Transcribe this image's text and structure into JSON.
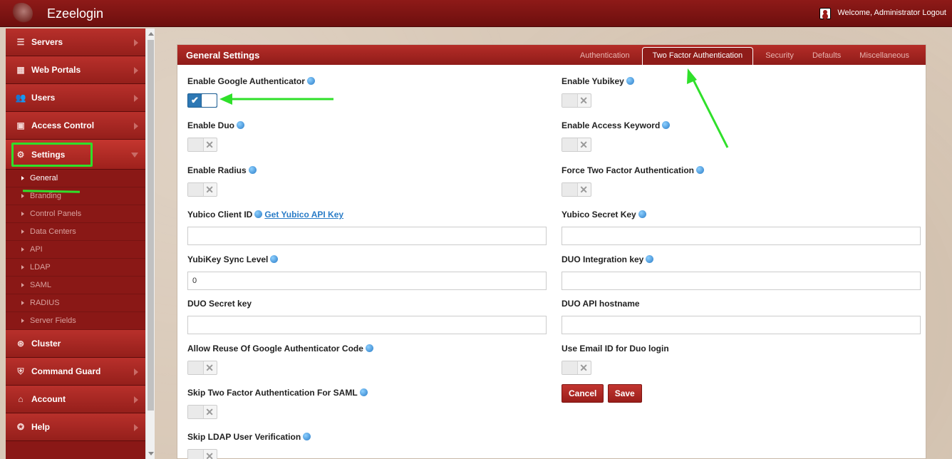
{
  "app": {
    "title": "Ezeelogin",
    "welcome": "Welcome, Administrator Logout"
  },
  "sidebar": {
    "items": [
      {
        "label": "Servers",
        "icon": "list-icon"
      },
      {
        "label": "Web Portals",
        "icon": "grid-icon"
      },
      {
        "label": "Users",
        "icon": "users-icon"
      },
      {
        "label": "Access Control",
        "icon": "lock-icon"
      },
      {
        "label": "Settings",
        "icon": "gears-icon"
      },
      {
        "label": "Cluster",
        "icon": "cluster-icon"
      },
      {
        "label": "Command Guard",
        "icon": "shield-icon"
      },
      {
        "label": "Account",
        "icon": "home-icon"
      },
      {
        "label": "Help",
        "icon": "lifebuoy-icon"
      }
    ],
    "settings_sub": [
      "General",
      "Branding",
      "Control Panels",
      "Data Centers",
      "API",
      "LDAP",
      "SAML",
      "RADIUS",
      "Server Fields"
    ]
  },
  "panel": {
    "title": "General Settings",
    "tabs": [
      "Authentication",
      "Two Factor Authentication",
      "Security",
      "Defaults",
      "Miscellaneous"
    ],
    "active_tab": "Two Factor Authentication"
  },
  "form": {
    "google_auth": {
      "label": "Enable Google Authenticator",
      "enabled": true
    },
    "yubikey": {
      "label": "Enable Yubikey",
      "enabled": false
    },
    "duo": {
      "label": "Enable Duo",
      "enabled": false
    },
    "access_keyword": {
      "label": "Enable Access Keyword",
      "enabled": false
    },
    "radius": {
      "label": "Enable Radius",
      "enabled": false
    },
    "force_2fa": {
      "label": "Force Two Factor Authentication",
      "enabled": false
    },
    "yubico_client_id": {
      "label": "Yubico Client ID",
      "link": "Get Yubico API Key",
      "value": ""
    },
    "yubico_secret": {
      "label": "Yubico Secret Key",
      "value": ""
    },
    "yubikey_sync": {
      "label": "YubiKey Sync Level",
      "value": "0"
    },
    "duo_integration": {
      "label": "DUO Integration key",
      "value": ""
    },
    "duo_secret": {
      "label": "DUO Secret key",
      "value": ""
    },
    "duo_api_host": {
      "label": "DUO API hostname",
      "value": ""
    },
    "reuse_google": {
      "label": "Allow Reuse Of Google Authenticator Code",
      "enabled": false
    },
    "duo_email": {
      "label": "Use Email ID for Duo login",
      "enabled": false
    },
    "skip_saml": {
      "label": "Skip Two Factor Authentication For SAML",
      "enabled": false
    },
    "skip_ldap": {
      "label": "Skip LDAP User Verification",
      "enabled": false
    },
    "cancel_label": "Cancel",
    "save_label": "Save"
  },
  "colors": {
    "accent": "#9b1b18",
    "annotation": "#2fe02a",
    "toggle_on": "#2d78b4"
  }
}
